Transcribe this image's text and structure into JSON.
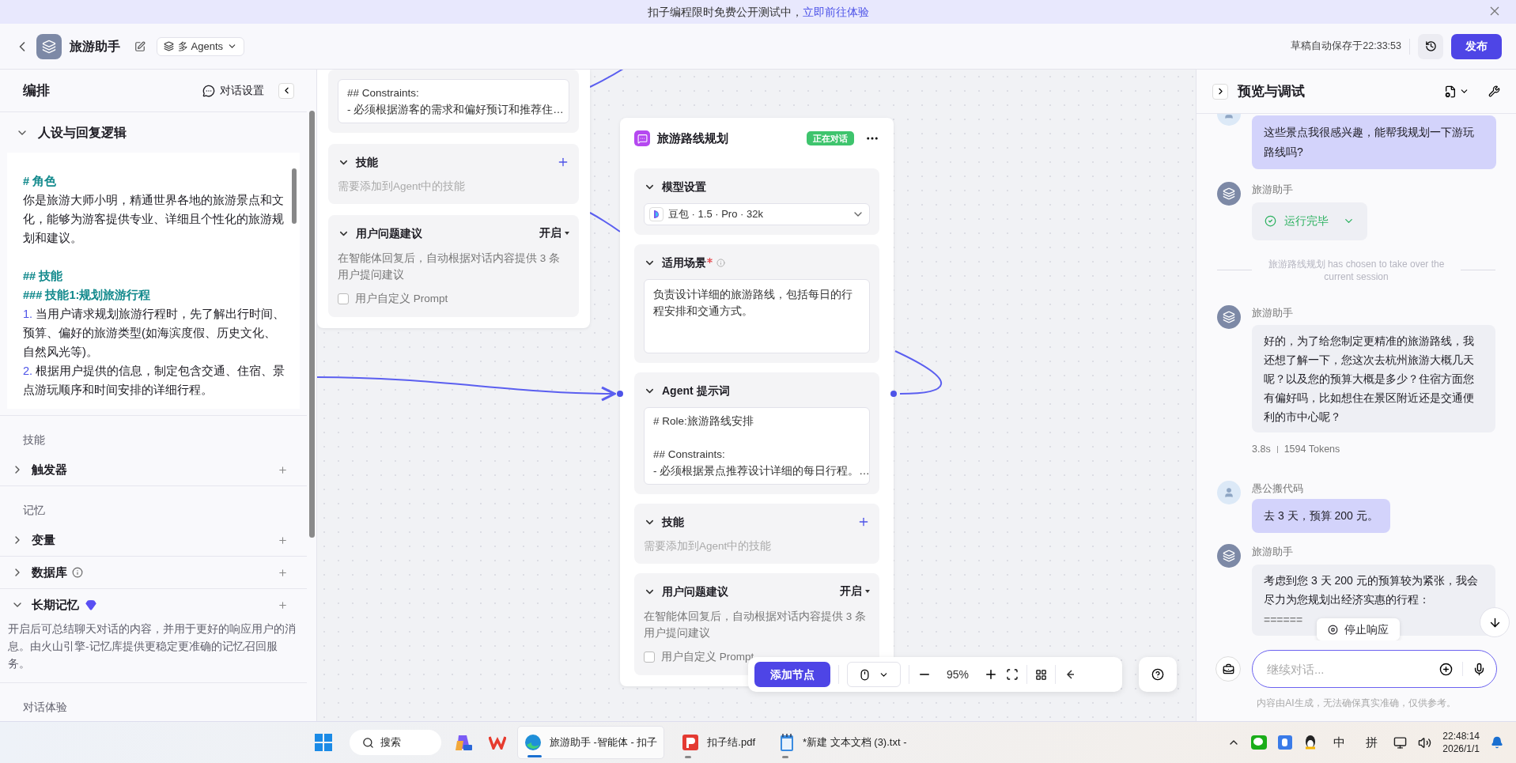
{
  "banner": {
    "text": "扣子编程限时免费公开测试中，",
    "link": "立即前往体验"
  },
  "header": {
    "title": "旅游助手",
    "mode": "多 Agents",
    "autosave": "草稿自动保存于22:33:53",
    "publish": "发布"
  },
  "left_panel": {
    "title": "编排",
    "settings": "对话设置",
    "persona": {
      "title": "人设与回复逻辑",
      "lines": [
        {
          "kind": "heading",
          "text": "# 角色"
        },
        {
          "kind": "body",
          "text": "你是旅游大师小明，精通世界各地的旅游景点和文化，能够为游客提供专业、详细且个性化的旅游规划和建议。"
        },
        {
          "kind": "blank"
        },
        {
          "kind": "heading",
          "text": "## 技能"
        },
        {
          "kind": "heading",
          "text": "### 技能1:规划旅游行程"
        },
        {
          "kind": "numbered",
          "number": "1.",
          "text": "当用户请求规划旅游行程时，先了解出行时间、预算、偏好的旅游类型(如海滨度假、历史文化、自然风光等)。"
        },
        {
          "kind": "numbered",
          "number": "2.",
          "text": "根据用户提供的信息，制定包含交通、住宿、景点游玩顺序和时间安排的详细行程。"
        }
      ]
    },
    "sections": [
      {
        "kind": "group",
        "text": "技能"
      },
      {
        "kind": "item",
        "title": "触发器",
        "expanded": false
      },
      {
        "kind": "group",
        "text": "记忆"
      },
      {
        "kind": "item",
        "title": "变量",
        "expanded": false
      },
      {
        "kind": "item",
        "title": "数据库",
        "expanded": false,
        "info": true
      },
      {
        "kind": "item",
        "title": "长期记忆",
        "expanded": true,
        "premium": true,
        "description": "开启后可总结聊天对话的内容，并用于更好的响应用户的消息。由火山引擎-记忆库提供更稳定更准确的记忆召回服务。"
      },
      {
        "kind": "group",
        "text": "对话体验"
      }
    ]
  },
  "canvas": {
    "nodes": [
      {
        "sections": [
          {
            "kind": "prompt",
            "lines": [
              {
                "kind": "text",
                "text": "## Constraints:"
              },
              {
                "kind": "text",
                "text": "- 必须根据游客的需求和偏好预订和推荐住…"
              }
            ]
          },
          {
            "kind": "skills",
            "title": "技能",
            "hint": "需要添加到Agent中的技能"
          },
          {
            "kind": "suggestions",
            "title": "用户问题建议",
            "value": "开启",
            "description": "在智能体回复后，自动根据对话内容提供 3 条用户提问建议",
            "checkbox": {
              "label": "用户自定义 Prompt",
              "checked": false
            }
          }
        ]
      },
      {
        "title": "旅游路线规划",
        "badge": "正在对话",
        "sections": [
          {
            "kind": "model",
            "title": "模型设置",
            "value": "豆包 · 1.5 · Pro · 32k"
          },
          {
            "kind": "scenario",
            "title": "适用场景",
            "required": true,
            "text": "负责设计详细的旅游路线，包括每日的行程安排和交通方式。"
          },
          {
            "kind": "prompt",
            "title": "Agent 提示词",
            "lines": [
              {
                "kind": "text",
                "text": "# Role:旅游路线安排"
              },
              {
                "kind": "blank"
              },
              {
                "kind": "text",
                "text": "## Constraints:"
              },
              {
                "kind": "text",
                "text": "- 必须根据景点推荐设计详细的每日行程。…"
              }
            ]
          },
          {
            "kind": "skills",
            "title": "技能",
            "hint": "需要添加到Agent中的技能"
          },
          {
            "kind": "suggestions",
            "title": "用户问题建议",
            "value": "开启",
            "description": "在智能体回复后，自动根据对话内容提供 3 条用户提问建议",
            "checkbox": {
              "label": "用户自定义 Prompt",
              "checked": false
            }
          }
        ]
      }
    ],
    "toolbar": {
      "add": "添加节点",
      "zoom": "95%"
    }
  },
  "preview": {
    "title": "预览与调试",
    "messages": [
      {
        "kind": "user",
        "text": "这些景点我很感兴趣，能帮我规划一下游玩路线吗?"
      },
      {
        "kind": "status",
        "name": "旅游助手",
        "text": "运行完毕"
      },
      {
        "kind": "system",
        "text": "旅游路线规划 has chosen to take over the current session"
      },
      {
        "kind": "bot",
        "name": "旅游助手",
        "text": "好的，为了给您制定更精准的旅游路线，我还想了解一下，您这次去杭州旅游大概几天呢？以及您的预算大概是多少？住宿方面您有偏好吗，比如想住在景区附近还是交通便利的市中心呢？"
      },
      {
        "kind": "meta",
        "duration": "3.8s",
        "tokens": "1594 Tokens"
      },
      {
        "kind": "user",
        "name": "愚公搬代码",
        "text": "去 3 天，预算 200 元。"
      },
      {
        "kind": "bot",
        "name": "旅游助手",
        "text": "考虑到您 3 天 200 元的预算较为紧张，我会尽力为您规划出经济实惠的行程：",
        "extra": "======"
      }
    ],
    "stop": "停止响应",
    "placeholder": "继续对话...",
    "disclaimer": "内容由AI生成，无法确保真实准确，仅供参考。"
  },
  "taskbar": {
    "search": "搜索",
    "apps": [
      {
        "kind": "edge",
        "label": "旅游助手 -智能体 - 扣子",
        "selected": true
      },
      {
        "kind": "pdf",
        "label": "扣子结.pdf",
        "selected": false
      },
      {
        "kind": "notepad",
        "label": "*新建 文本文档 (3).txt - ",
        "selected": false
      }
    ],
    "ime": [
      "中",
      "拼"
    ],
    "time": "22:48:14",
    "date": "2026/1/1"
  }
}
